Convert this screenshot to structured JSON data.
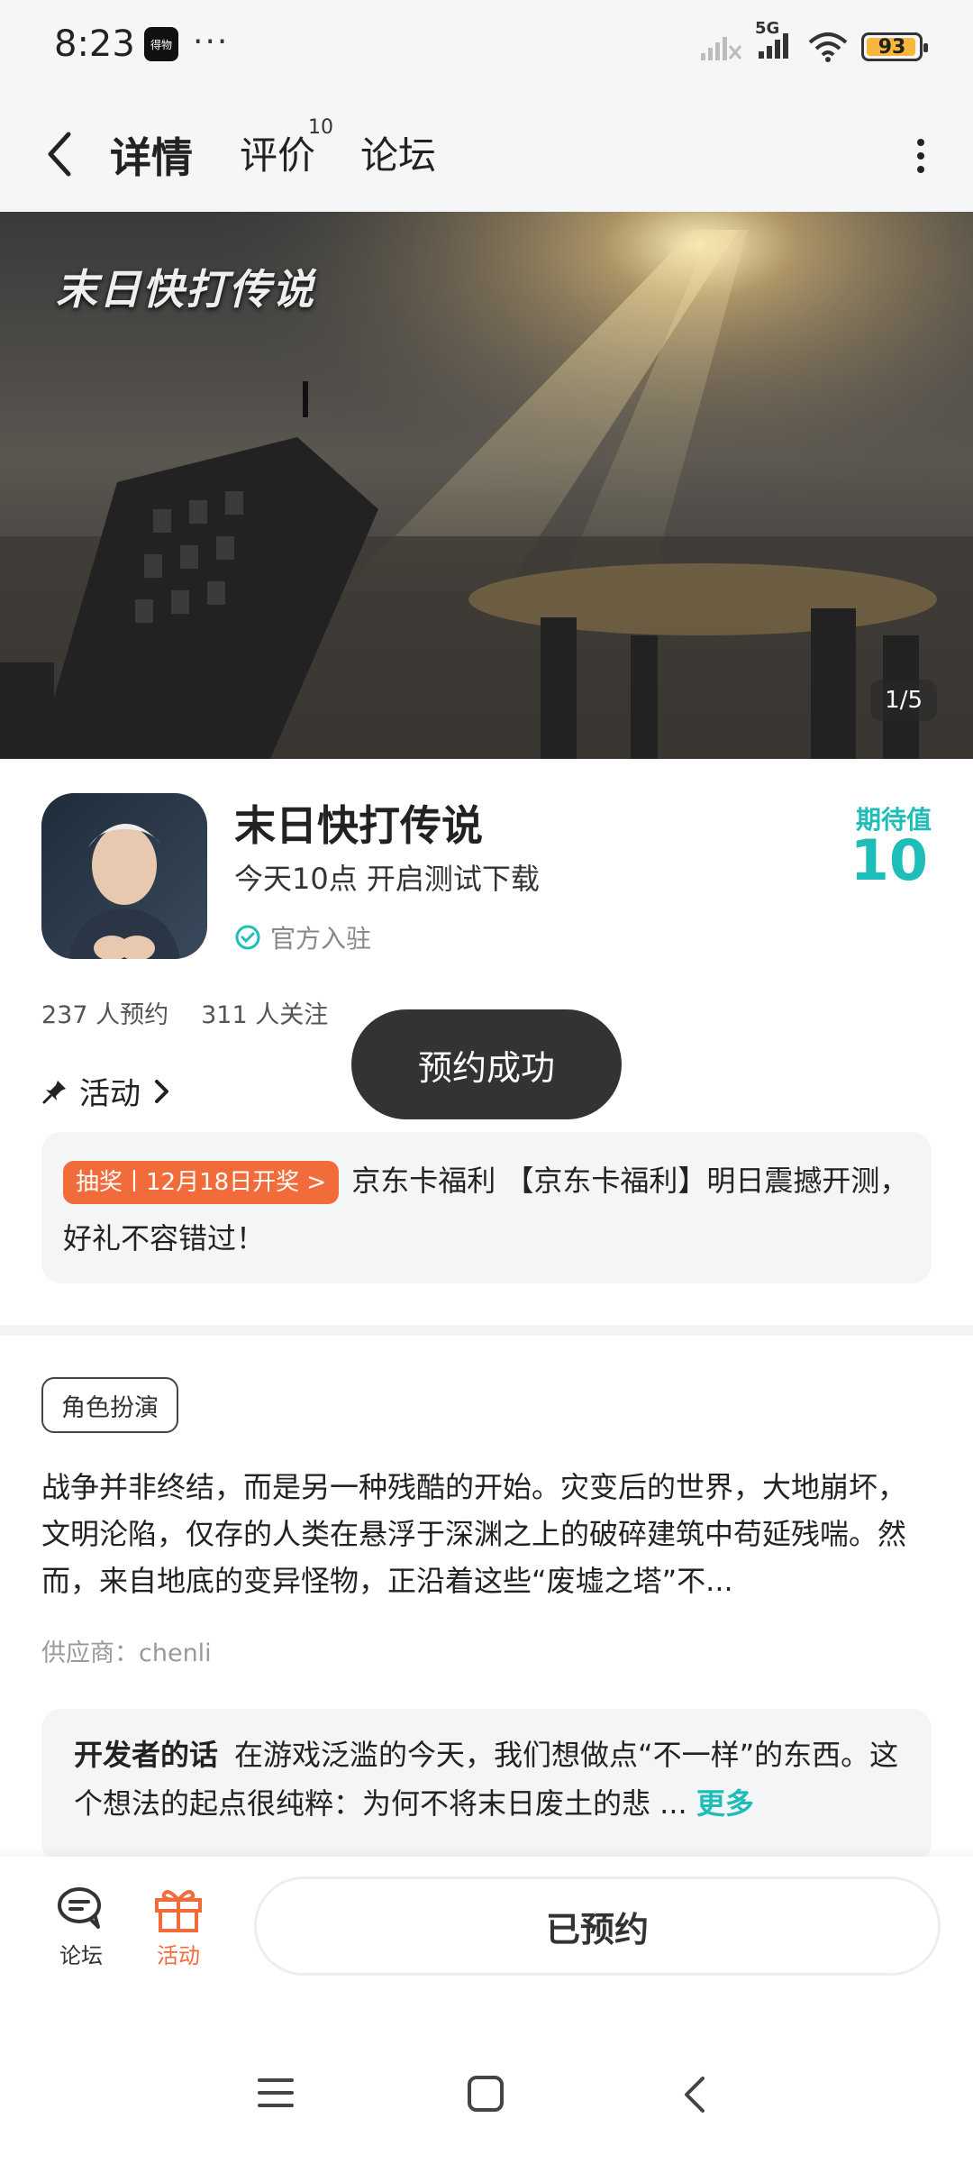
{
  "status_bar": {
    "time": "8:23",
    "app_icon_text": "得物",
    "dots": "···",
    "network": "5G",
    "battery": "93"
  },
  "nav": {
    "tabs": [
      {
        "label": "详情"
      },
      {
        "label": "评价",
        "badge": "10"
      },
      {
        "label": "论坛"
      }
    ]
  },
  "banner": {
    "logo_text": "末日快打传说",
    "counter": "1/5"
  },
  "app": {
    "title": "末日快打传说",
    "subtitle": "今天10点 开启测试下载",
    "official": "官方入驻",
    "expect_label": "期待值",
    "expect_value": "10",
    "reservations": "237 人预约",
    "followers": "311 人关注"
  },
  "activity": {
    "label": "活动"
  },
  "toast": "预约成功",
  "promo": {
    "tag": "抽奖丨12月18日开奖 >",
    "text": "京东卡福利 【京东卡福利】明日震撼开测，好礼不容错过！"
  },
  "genre": "角色扮演",
  "description": "战争并非终结，而是另一种残酷的开始。灾变后的世界，大地崩坏，文明沦陷，仅存的人类在悬浮于深渊之上的破碎建筑中苟延残喘。然而，来自地底的变异怪物，正沿着这些“废墟之塔”不...",
  "supplier": "供应商：chenli",
  "developer": {
    "title": "开发者的话",
    "text": "在游戏泛滥的今天，我们想做点“不一样”的东西。这个想法的起点很纯粹：为何不将末日废土的悲 ...",
    "more": "更多"
  },
  "bottom_bar": {
    "forum": "论坛",
    "activity": "活动",
    "reserved": "已预约"
  },
  "colors": {
    "accent": "#1fbdb9",
    "orange": "#f26b3a"
  }
}
